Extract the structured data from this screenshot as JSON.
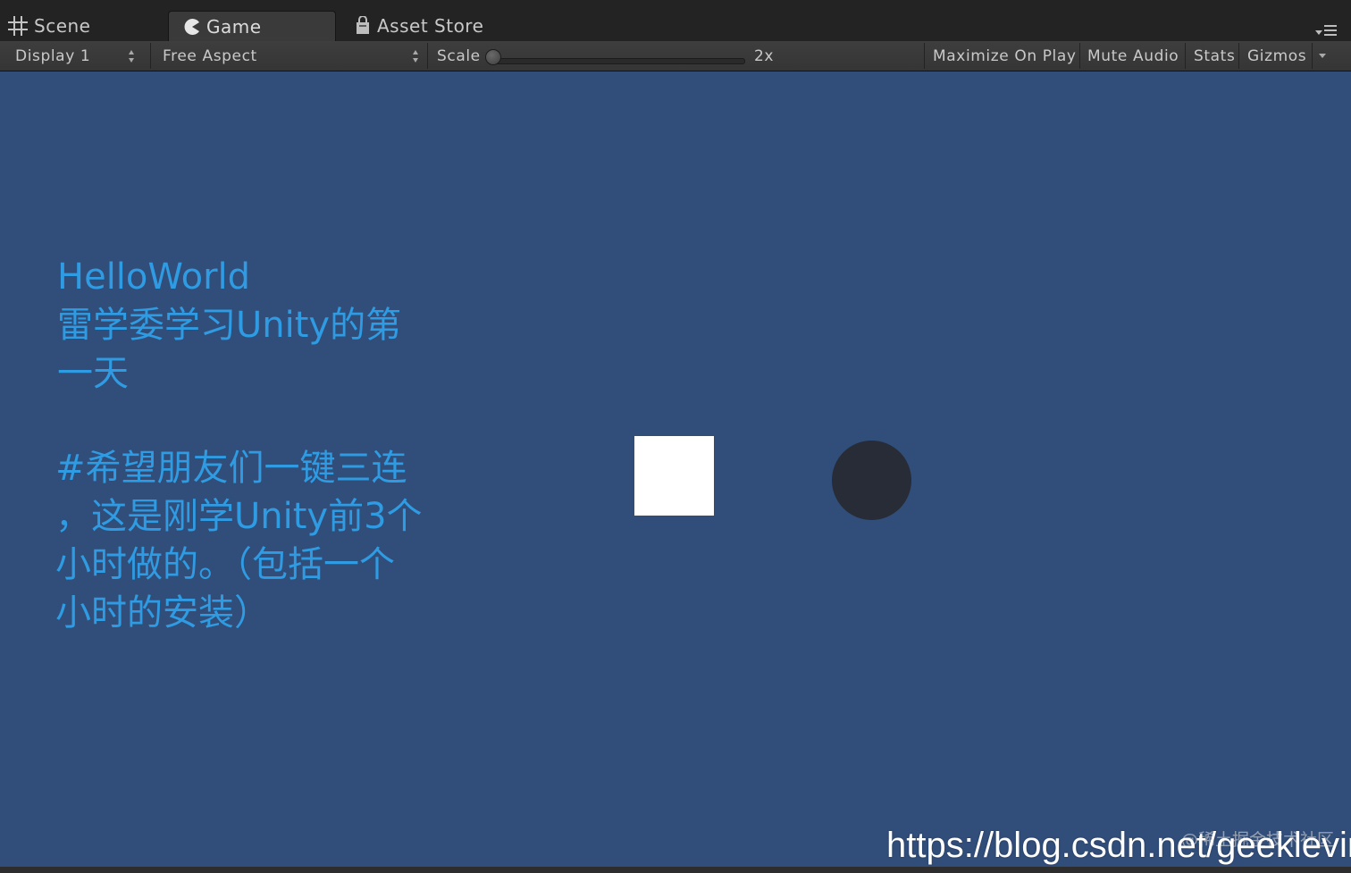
{
  "tabs": {
    "scene_label": "Scene",
    "game_label": "Game",
    "asset_store_label": "Asset Store"
  },
  "toolbar": {
    "display_label": "Display 1",
    "aspect_label": "Free Aspect",
    "scale_label": "Scale",
    "scale_value": "2x",
    "maximize_label": "Maximize On Play",
    "mute_label": "Mute Audio",
    "stats_label": "Stats",
    "gizmos_label": "Gizmos"
  },
  "game_view": {
    "background_color": "#314d79",
    "text_color": "#2f9be2",
    "hello_text": "HelloWorld\n雷学委学习Unity的第\n一天",
    "wish_text": "#希望朋友们一键三连\n，这是刚学Unity前3个\n小时做的。（包括一个\n小时的安装）",
    "square_color": "#ffffff",
    "circle_color": "#272c36"
  },
  "watermark": {
    "url_text": "https://blog.csdn.net/geeklevin",
    "faint_text": "@稀土掘金技术社区"
  }
}
